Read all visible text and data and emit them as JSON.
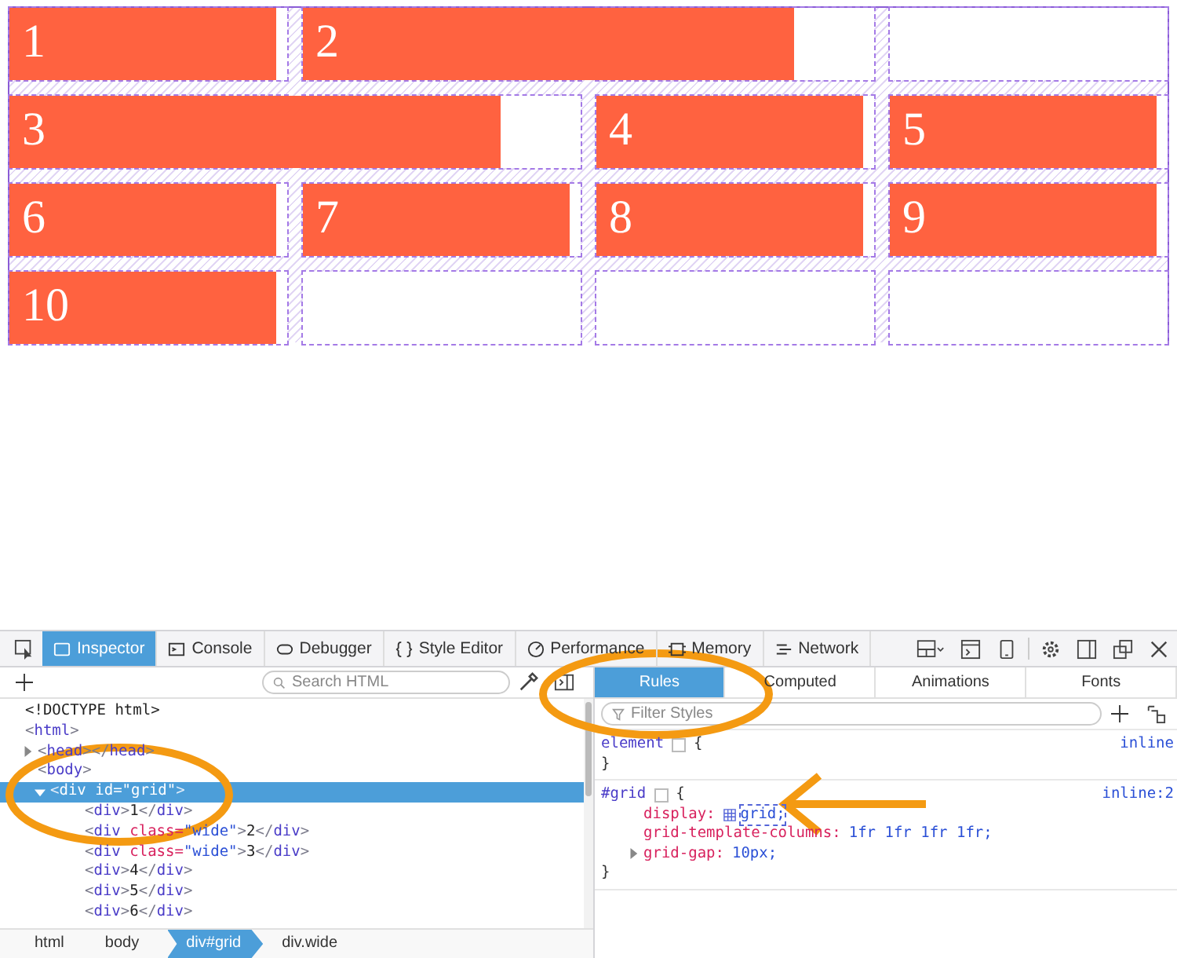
{
  "grid_items": [
    {
      "label": "1",
      "kind": "normal"
    },
    {
      "label": "2",
      "kind": "wide"
    },
    {
      "label": "3",
      "kind": "wide"
    },
    {
      "label": "4",
      "kind": "normal"
    },
    {
      "label": "5",
      "kind": "normal"
    },
    {
      "label": "6",
      "kind": "normal"
    },
    {
      "label": "7",
      "kind": "normal"
    },
    {
      "label": "8",
      "kind": "normal"
    },
    {
      "label": "9",
      "kind": "normal"
    },
    {
      "label": "10",
      "kind": "normal"
    }
  ],
  "toolbar_tabs": [
    {
      "label": "Inspector",
      "kind": "inspector",
      "selected": true
    },
    {
      "label": "Console",
      "kind": "console",
      "selected": false
    },
    {
      "label": "Debugger",
      "kind": "debugger",
      "selected": false
    },
    {
      "label": "Style Editor",
      "kind": "style",
      "selected": false
    },
    {
      "label": "Performance",
      "kind": "performance",
      "selected": false
    },
    {
      "label": "Memory",
      "kind": "memory",
      "selected": false
    },
    {
      "label": "Network",
      "kind": "network",
      "selected": false
    }
  ],
  "search": {
    "placeholder": "Search HTML"
  },
  "markup": [
    {
      "parts": [
        {
          "kind": "text",
          "text": "<!DOCTYPE html>"
        }
      ]
    },
    {
      "parts": [
        {
          "kind": "bracket",
          "text": "<"
        },
        {
          "kind": "tag",
          "text": "html"
        },
        {
          "kind": "bracket",
          "text": ">"
        }
      ],
      "children": [
        {
          "parts": [
            {
              "kind": "bracket",
              "text": "<"
            },
            {
              "kind": "tag",
              "text": "head"
            },
            {
              "kind": "bracket",
              "text": "></"
            },
            {
              "kind": "tag",
              "text": "head"
            },
            {
              "kind": "bracket",
              "text": ">"
            }
          ],
          "expanded": false,
          "selected": false
        },
        {
          "parts": [
            {
              "kind": "bracket",
              "text": "<"
            },
            {
              "kind": "tag",
              "text": "body"
            },
            {
              "kind": "bracket",
              "text": ">"
            }
          ],
          "children": [
            {
              "parts": [
                {
                  "kind": "bracket",
                  "text": "<"
                },
                {
                  "kind": "tag",
                  "text": "div"
                },
                {
                  "kind": "attr",
                  "text": " id="
                },
                {
                  "kind": "value",
                  "text": "\"grid\""
                },
                {
                  "kind": "bracket",
                  "text": ">"
                }
              ],
              "expanded": true,
              "selected": true,
              "children": [
                {
                  "parts": [
                    {
                      "kind": "bracket",
                      "text": "<"
                    },
                    {
                      "kind": "tag",
                      "text": "div"
                    },
                    {
                      "kind": "bracket",
                      "text": ">"
                    },
                    {
                      "kind": "text",
                      "text": "1"
                    },
                    {
                      "kind": "bracket",
                      "text": "</"
                    },
                    {
                      "kind": "tag",
                      "text": "div"
                    },
                    {
                      "kind": "bracket",
                      "text": ">"
                    }
                  ]
                },
                {
                  "parts": [
                    {
                      "kind": "bracket",
                      "text": "<"
                    },
                    {
                      "kind": "tag",
                      "text": "div"
                    },
                    {
                      "kind": "attr",
                      "text": " class="
                    },
                    {
                      "kind": "value",
                      "text": "\"wide\""
                    },
                    {
                      "kind": "bracket",
                      "text": ">"
                    },
                    {
                      "kind": "text",
                      "text": "2"
                    },
                    {
                      "kind": "bracket",
                      "text": "</"
                    },
                    {
                      "kind": "tag",
                      "text": "div"
                    },
                    {
                      "kind": "bracket",
                      "text": ">"
                    }
                  ]
                },
                {
                  "parts": [
                    {
                      "kind": "bracket",
                      "text": "<"
                    },
                    {
                      "kind": "tag",
                      "text": "div"
                    },
                    {
                      "kind": "attr",
                      "text": " class="
                    },
                    {
                      "kind": "value",
                      "text": "\"wide\""
                    },
                    {
                      "kind": "bracket",
                      "text": ">"
                    },
                    {
                      "kind": "text",
                      "text": "3"
                    },
                    {
                      "kind": "bracket",
                      "text": "</"
                    },
                    {
                      "kind": "tag",
                      "text": "div"
                    },
                    {
                      "kind": "bracket",
                      "text": ">"
                    }
                  ]
                },
                {
                  "parts": [
                    {
                      "kind": "bracket",
                      "text": "<"
                    },
                    {
                      "kind": "tag",
                      "text": "div"
                    },
                    {
                      "kind": "bracket",
                      "text": ">"
                    },
                    {
                      "kind": "text",
                      "text": "4"
                    },
                    {
                      "kind": "bracket",
                      "text": "</"
                    },
                    {
                      "kind": "tag",
                      "text": "div"
                    },
                    {
                      "kind": "bracket",
                      "text": ">"
                    }
                  ]
                },
                {
                  "parts": [
                    {
                      "kind": "bracket",
                      "text": "<"
                    },
                    {
                      "kind": "tag",
                      "text": "div"
                    },
                    {
                      "kind": "bracket",
                      "text": ">"
                    },
                    {
                      "kind": "text",
                      "text": "5"
                    },
                    {
                      "kind": "bracket",
                      "text": "</"
                    },
                    {
                      "kind": "tag",
                      "text": "div"
                    },
                    {
                      "kind": "bracket",
                      "text": ">"
                    }
                  ]
                },
                {
                  "parts": [
                    {
                      "kind": "bracket",
                      "text": "<"
                    },
                    {
                      "kind": "tag",
                      "text": "div"
                    },
                    {
                      "kind": "bracket",
                      "text": ">"
                    },
                    {
                      "kind": "text",
                      "text": "6"
                    },
                    {
                      "kind": "bracket",
                      "text": "</"
                    },
                    {
                      "kind": "tag",
                      "text": "div"
                    },
                    {
                      "kind": "bracket",
                      "text": ">"
                    }
                  ]
                }
              ]
            }
          ]
        }
      ]
    }
  ],
  "breadcrumbs": [
    {
      "label": "html",
      "selected": false
    },
    {
      "label": "body",
      "selected": false
    },
    {
      "label": "div#grid",
      "selected": true
    },
    {
      "label": "div.wide",
      "selected": false
    }
  ],
  "sidebar_tabs": [
    {
      "label": "Rules",
      "selected": true
    },
    {
      "label": "Computed",
      "selected": false
    },
    {
      "label": "Animations",
      "selected": false
    },
    {
      "label": "Fonts",
      "selected": false
    }
  ],
  "filter": {
    "placeholder": "Filter Styles"
  },
  "rules": [
    {
      "selector": "element",
      "open": "{",
      "source": "inline",
      "close": "}"
    },
    {
      "selector": "#grid",
      "open": "{",
      "source": "inline:2",
      "close": "}",
      "declarations": [
        {
          "kind": "grid",
          "property": "display:",
          "value": "grid;"
        },
        {
          "kind": "plain",
          "property": "grid-template-columns:",
          "value": "1fr 1fr 1fr 1fr;"
        },
        {
          "kind": "shorthand",
          "property": "grid-gap:",
          "value": "10px;",
          "expanded": false
        }
      ]
    }
  ]
}
